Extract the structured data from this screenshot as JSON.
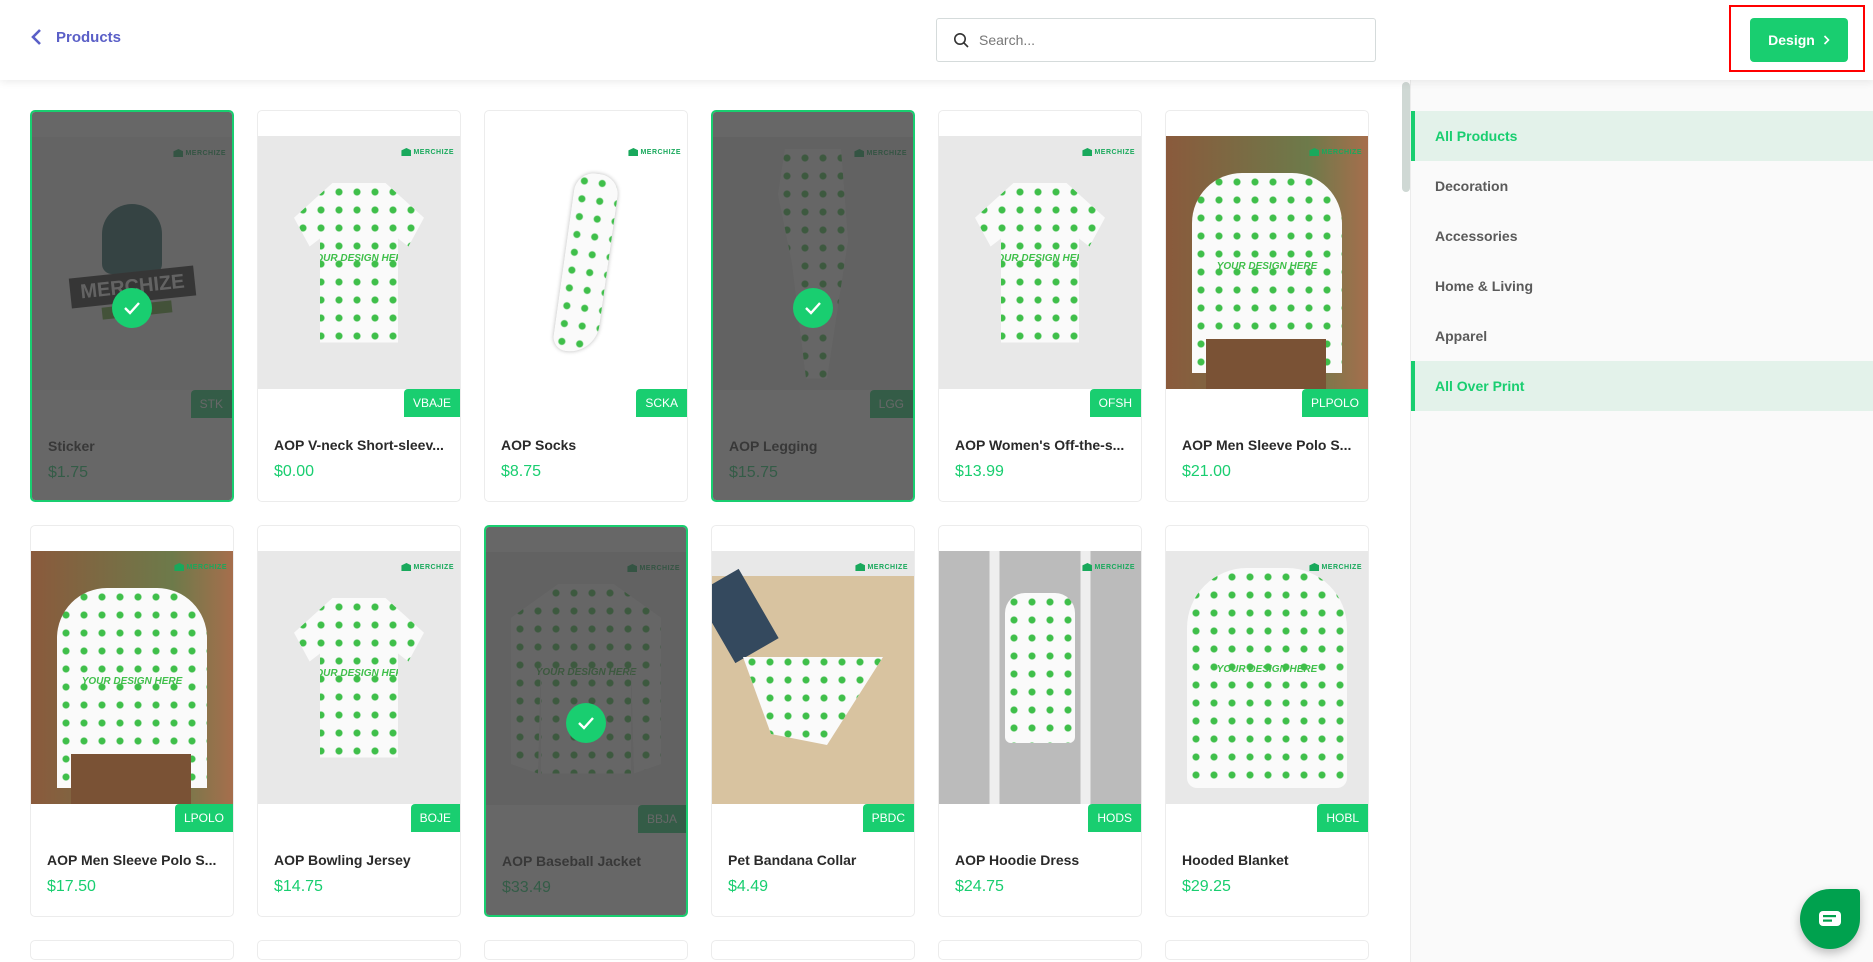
{
  "header": {
    "back_label": "Products",
    "search_placeholder": "Search...",
    "search_value": "",
    "design_label": "Design",
    "brand_color": "#19ce70",
    "back_color": "#5a5fc7"
  },
  "products": [
    {
      "name": "Sticker",
      "price": "$1.75",
      "sku": "STK",
      "selected": true,
      "art": "sticker"
    },
    {
      "name": "AOP V-neck Short-sleev...",
      "price": "$0.00",
      "sku": "VBAJE",
      "selected": false,
      "art": "shirt"
    },
    {
      "name": "AOP Socks",
      "price": "$8.75",
      "sku": "SCKA",
      "selected": false,
      "art": "socks"
    },
    {
      "name": "AOP Legging",
      "price": "$15.75",
      "sku": "LGG",
      "selected": true,
      "art": "legging"
    },
    {
      "name": "AOP Women's Off-the-s...",
      "price": "$13.99",
      "sku": "OFSH",
      "selected": false,
      "art": "shirt"
    },
    {
      "name": "AOP Men Sleeve Polo S...",
      "price": "$21.00",
      "sku": "PLPOLO",
      "selected": false,
      "art": "photo-polo"
    },
    {
      "name": "AOP Men Sleeve Polo S...",
      "price": "$17.50",
      "sku": "LPOLO",
      "selected": false,
      "art": "photo-polo"
    },
    {
      "name": "AOP Bowling Jersey",
      "price": "$14.75",
      "sku": "BOJE",
      "selected": false,
      "art": "shirt"
    },
    {
      "name": "AOP Baseball Jacket",
      "price": "$33.49",
      "sku": "BBJA",
      "selected": true,
      "art": "jacket"
    },
    {
      "name": "Pet Bandana Collar",
      "price": "$4.49",
      "sku": "PBDC",
      "selected": false,
      "art": "bandana"
    },
    {
      "name": "AOP Hoodie Dress",
      "price": "$24.75",
      "sku": "HODS",
      "selected": false,
      "art": "photo-dress"
    },
    {
      "name": "Hooded Blanket",
      "price": "$29.25",
      "sku": "HOBL",
      "selected": false,
      "art": "blanket"
    }
  ],
  "product_common": {
    "watermark": "MERCHIZE",
    "art_text": "YOUR DESIGN HERE"
  },
  "sidebar": {
    "categories": [
      {
        "label": "All Products",
        "active": true
      },
      {
        "label": "Decoration",
        "active": false
      },
      {
        "label": "Accessories",
        "active": false
      },
      {
        "label": "Home & Living",
        "active": false
      },
      {
        "label": "Apparel",
        "active": false
      },
      {
        "label": "All Over Print",
        "active": true
      }
    ]
  },
  "chat": {
    "icon": "chat-bubble-icon"
  }
}
